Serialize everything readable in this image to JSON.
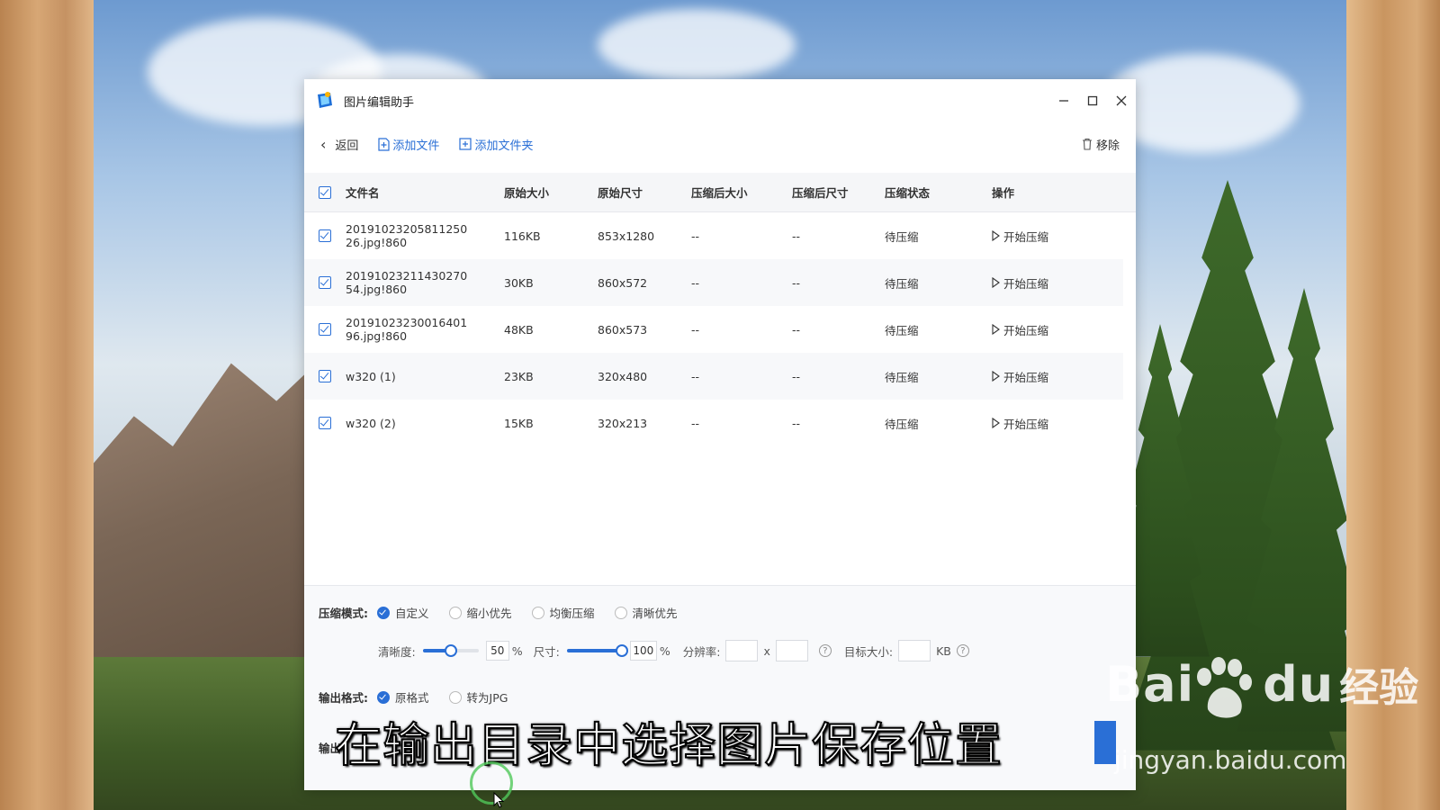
{
  "window": {
    "title": "图片编辑助手",
    "controls": {
      "minimize": "–",
      "close": "X"
    }
  },
  "toolbar": {
    "back_label": "返回",
    "add_file_label": "添加文件",
    "add_folder_label": "添加文件夹",
    "remove_label": "移除"
  },
  "table": {
    "headers": [
      "文件名",
      "原始大小",
      "原始尺寸",
      "压缩后大小",
      "压缩后尺寸",
      "压缩状态",
      "操作"
    ],
    "rows": [
      {
        "name": "20191023205811250 26.jpg!860",
        "orig_size": "116KB",
        "orig_dim": "853x1280",
        "comp_size": "--",
        "comp_dim": "--",
        "status": "待压缩",
        "action": "开始压缩"
      },
      {
        "name": "20191023211430270 54.jpg!860",
        "orig_size": "30KB",
        "orig_dim": "860x572",
        "comp_size": "--",
        "comp_dim": "--",
        "status": "待压缩",
        "action": "开始压缩"
      },
      {
        "name": "20191023230016401 96.jpg!860",
        "orig_size": "48KB",
        "orig_dim": "860x573",
        "comp_size": "--",
        "comp_dim": "--",
        "status": "待压缩",
        "action": "开始压缩"
      },
      {
        "name": "w320 (1)",
        "orig_size": "23KB",
        "orig_dim": "320x480",
        "comp_size": "--",
        "comp_dim": "--",
        "status": "待压缩",
        "action": "开始压缩"
      },
      {
        "name": "w320 (2)",
        "orig_size": "15KB",
        "orig_dim": "320x213",
        "comp_size": "--",
        "comp_dim": "--",
        "status": "待压缩",
        "action": "开始压缩"
      }
    ]
  },
  "compress": {
    "mode_label": "压缩模式:",
    "modes": [
      "自定义",
      "缩小优先",
      "均衡压缩",
      "清晰优先"
    ],
    "selected_mode": "自定义",
    "clarity_label": "清晰度:",
    "clarity_value": "50",
    "clarity_fraction": 0.5,
    "size_label": "尺寸:",
    "size_value": "100",
    "size_fraction": 1.0,
    "percent": "%",
    "resolution_label": "分辨率:",
    "times": "x",
    "target_label": "目标大小:",
    "kb": "KB",
    "help": "?"
  },
  "output": {
    "format_label": "输出格式:",
    "formats": [
      "原格式",
      "转为JPG"
    ],
    "selected_format": "原格式",
    "dir_label_partial": "输出"
  },
  "overlay": {
    "subtitle": "在输出目录中选择图片保存位置",
    "watermark_brand": "Bai",
    "watermark_du": "du",
    "watermark_jingyan": "经验",
    "watermark_url": "jingyan.baidu.com"
  },
  "colors": {
    "accent": "#2a6fd6"
  }
}
